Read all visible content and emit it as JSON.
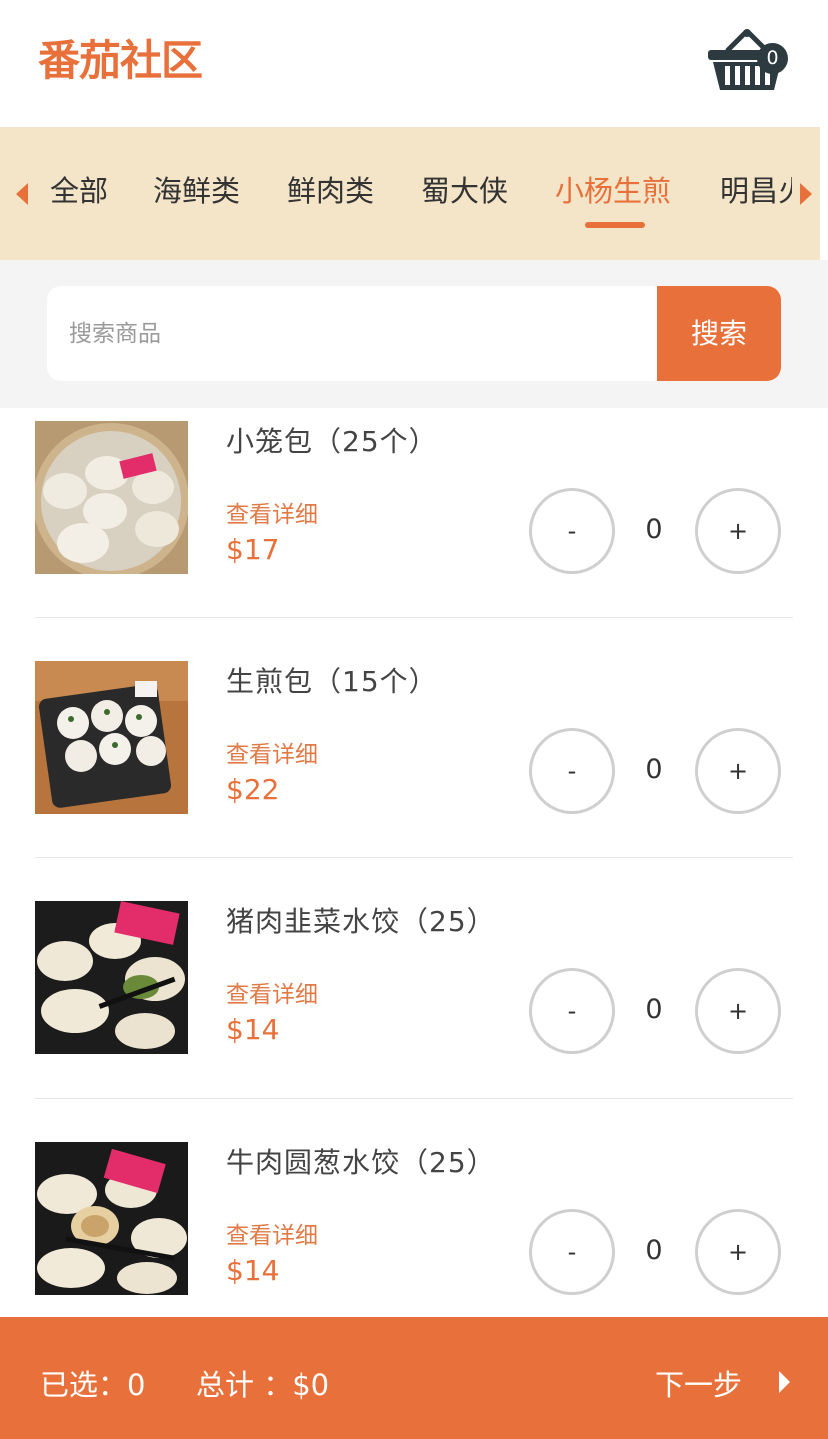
{
  "header": {
    "logo": "番茄社区",
    "cart_count": "0"
  },
  "tabs": {
    "items": [
      {
        "label": "全部"
      },
      {
        "label": "海鲜类"
      },
      {
        "label": "鲜肉类"
      },
      {
        "label": "蜀大侠"
      },
      {
        "label": "小杨生煎"
      },
      {
        "label": "明昌火锅"
      }
    ],
    "active_index": 4
  },
  "search": {
    "placeholder": "搜索商品",
    "button": "搜索"
  },
  "products": [
    {
      "name": "小笼包（25个）",
      "detail": "查看详细",
      "price": "$17",
      "qty": "0",
      "minus": "-",
      "plus": "+"
    },
    {
      "name": "生煎包（15个）",
      "detail": "查看详细",
      "price": "$22",
      "qty": "0",
      "minus": "-",
      "plus": "+"
    },
    {
      "name": "猪肉韭菜水饺（25）",
      "detail": "查看详细",
      "price": "$14",
      "qty": "0",
      "minus": "-",
      "plus": "+"
    },
    {
      "name": "牛肉圆葱水饺（25）",
      "detail": "查看详细",
      "price": "$14",
      "qty": "0",
      "minus": "-",
      "plus": "+"
    }
  ],
  "bottom": {
    "selected": "已选：0",
    "total": "总计 ：$0",
    "next": "下一步"
  },
  "colors": {
    "accent": "#e8703a",
    "tab_bg": "#f4e4c8",
    "dark": "#2d3a3f"
  }
}
